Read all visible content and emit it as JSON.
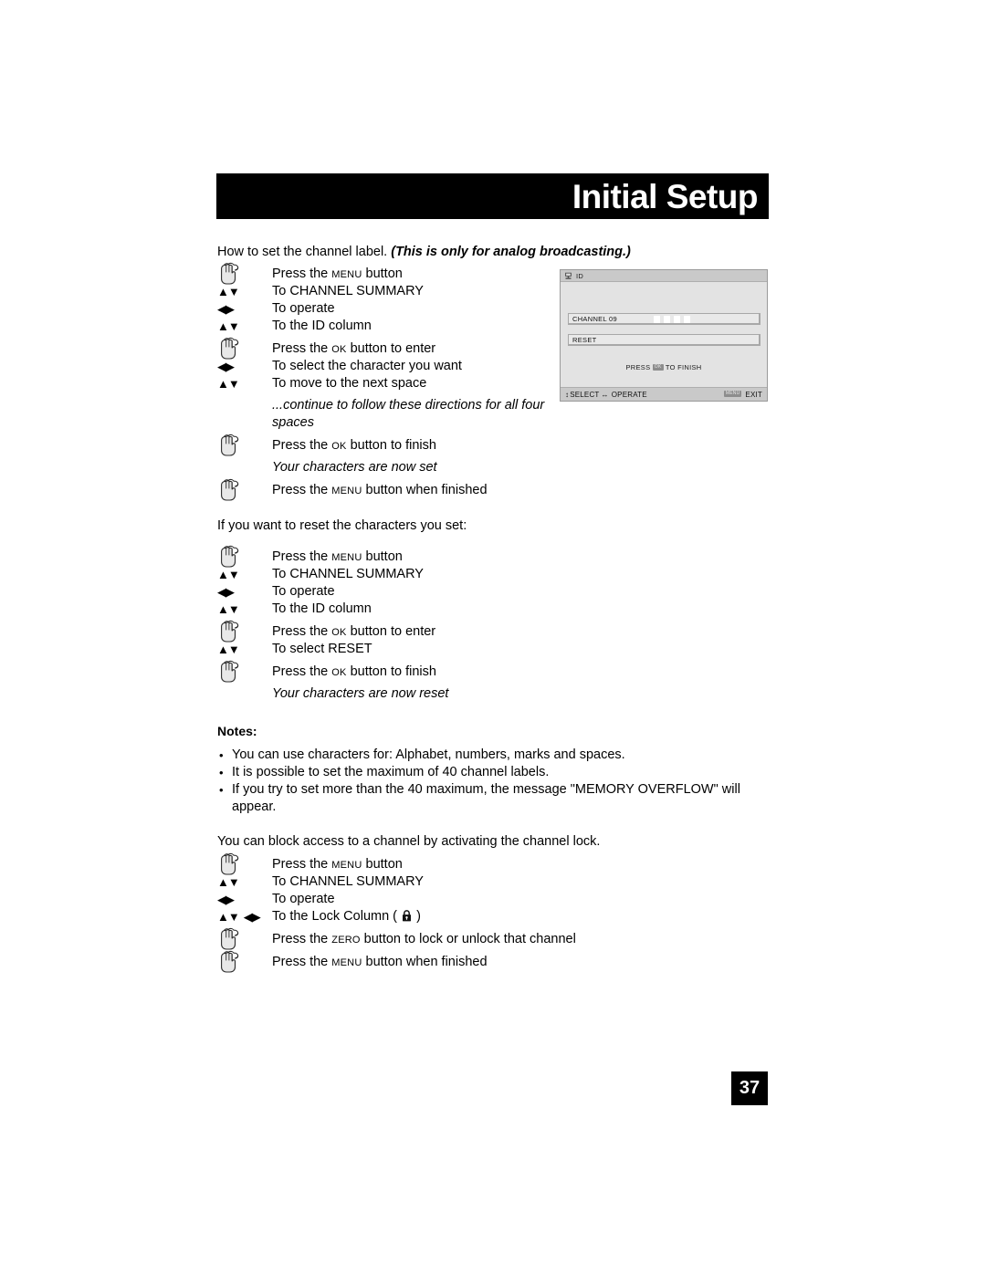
{
  "header": {
    "title": "Initial Setup"
  },
  "intro": {
    "normal": "How to set the channel label.",
    "emphasis": "(This is only for analog broadcasting.)"
  },
  "steps_set": [
    {
      "cue": "hand-icon",
      "pre": "Press the ",
      "key": "Menu",
      "post": " button"
    },
    {
      "cue": "updown",
      "text": "To CHANNEL SUMMARY"
    },
    {
      "cue": "leftright",
      "text": "To operate"
    },
    {
      "cue": "updown",
      "text": "To the ID column"
    },
    {
      "cue": "hand-icon",
      "pre": "Press the ",
      "key": "Ok",
      "post": " button to enter"
    },
    {
      "cue": "leftright",
      "text": "To select the character you want"
    },
    {
      "cue": "updown",
      "text": "To move to the next space"
    },
    {
      "cue": "none",
      "text": "...continue to follow these directions for all four spaces",
      "style": "wrap"
    },
    {
      "cue": "hand-icon",
      "pre": "Press the ",
      "key": "Ok",
      "post": " button to finish"
    },
    {
      "cue": "none",
      "text": "Your characters are now set",
      "style": "italic"
    },
    {
      "cue": "hand-icon",
      "pre": "Press the ",
      "key": "Menu",
      "post": " button when finished"
    }
  ],
  "reset_intro": "If you want to reset the characters you set:",
  "steps_reset": [
    {
      "cue": "hand-icon",
      "pre": "Press the ",
      "key": "Menu",
      "post": " button"
    },
    {
      "cue": "updown",
      "text": "To CHANNEL SUMMARY"
    },
    {
      "cue": "leftright",
      "text": "To operate"
    },
    {
      "cue": "updown",
      "text": "To the ID column"
    },
    {
      "cue": "hand-icon",
      "pre": "Press the ",
      "key": "Ok",
      "post": " button to enter"
    },
    {
      "cue": "updown",
      "text": "To select RESET"
    },
    {
      "cue": "hand-icon",
      "pre": "Press the ",
      "key": "Ok",
      "post": " button to finish"
    },
    {
      "cue": "none",
      "text": "Your characters are now reset",
      "style": "italic"
    }
  ],
  "notes": {
    "title": "Notes:",
    "bullet": "•",
    "items": [
      "You can use characters for: Alphabet, numbers, marks and spaces.",
      "It is possible to set the maximum of 40 channel labels.",
      "If you try to set more than the 40 maximum, the message \"MEMORY OVERFLOW\" will appear."
    ]
  },
  "lock_intro": "You can block access to a channel by activating the channel lock.",
  "steps_lock": [
    {
      "cue": "hand-icon",
      "pre": "Press the ",
      "key": "Menu",
      "post": " button"
    },
    {
      "cue": "updown",
      "text": "To CHANNEL SUMMARY"
    },
    {
      "cue": "leftright",
      "text": "To operate"
    },
    {
      "cue": "updown-leftright",
      "pre": "To the Lock Column ( ",
      "icon": "lock-icon",
      "post": " )"
    },
    {
      "cue": "hand-icon",
      "pre": "Press the ",
      "key": "Zero",
      "post": " button to lock or unlock that channel"
    },
    {
      "cue": "hand-icon",
      "pre": "Press the ",
      "key": "Menu",
      "post": " button when finished"
    }
  ],
  "osd": {
    "title": "ID",
    "title_icon": "tv-id-icon",
    "rows": [
      {
        "label": "CHANNEL 09",
        "char_boxes": 4
      },
      {
        "label": "RESET",
        "char_boxes": 0
      }
    ],
    "finish_pre": "PRESS ",
    "finish_badge": "OK",
    "finish_post": " TO FINISH",
    "footer_left_glyph": "↕",
    "footer_left_text": "SELECT",
    "footer_mid_glyph": "↔",
    "footer_mid_text": "OPERATE",
    "footer_right_badge": "MENU",
    "footer_right_text": "EXIT"
  },
  "page_number": "37",
  "glyphs": {
    "up": "▲",
    "down": "▼",
    "left": "◀",
    "right": "▶"
  },
  "colors": {
    "banner": "#000000",
    "osd_bg": "#e3e3e3",
    "osd_bar": "#c9c9c9",
    "page_badge": "#000000"
  }
}
